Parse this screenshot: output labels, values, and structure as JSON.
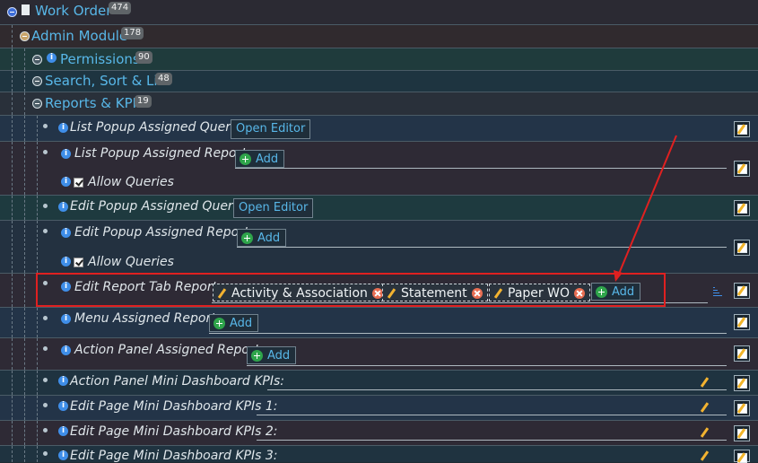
{
  "tree": {
    "work_order": {
      "label": "Work Order",
      "count": "474"
    },
    "admin_module": {
      "label": "Admin Module",
      "count": "178"
    },
    "permissions": {
      "label": "Permissions",
      "count": "90"
    },
    "search_sort_list": {
      "label": "Search, Sort & List",
      "count": "48"
    },
    "reports_kpis": {
      "label": "Reports & KPIs",
      "count": "19"
    }
  },
  "settings": {
    "list_popup_queries": {
      "label": "List Popup Assigned Queries:",
      "button": "Open Editor"
    },
    "list_popup_reports": {
      "label": "List Popup Assigned Reports:",
      "button": "Add"
    },
    "allow_queries_1": {
      "label": "Allow Queries"
    },
    "edit_popup_queries": {
      "label": "Edit Popup Assigned Queries:",
      "button": "Open Editor"
    },
    "edit_popup_reports": {
      "label": "Edit Popup Assigned Reports:",
      "button": "Add"
    },
    "allow_queries_2": {
      "label": "Allow Queries"
    },
    "edit_report_tab": {
      "label": "Edit Report Tab Reports:",
      "chips": [
        "Activity & Association",
        "Statement",
        "Paper WO"
      ],
      "button": "Add"
    },
    "menu_reports": {
      "label": "Menu Assigned Reports:",
      "button": "Add"
    },
    "action_panel_reports": {
      "label": "Action Panel Assigned Reports:",
      "button": "Add"
    },
    "action_panel_mini_kpis": {
      "label": "Action Panel Mini Dashboard KPIs:"
    },
    "edit_page_kpis_1": {
      "label": "Edit Page Mini Dashboard KPIs 1:"
    },
    "edit_page_kpis_2": {
      "label": "Edit Page Mini Dashboard KPIs 2:"
    },
    "edit_page_kpis_3": {
      "label": "Edit Page Mini Dashboard KPIs 3:"
    }
  },
  "colors": {
    "highlight": "#e02020",
    "link": "#58b7e8",
    "add": "#2fa54b"
  }
}
